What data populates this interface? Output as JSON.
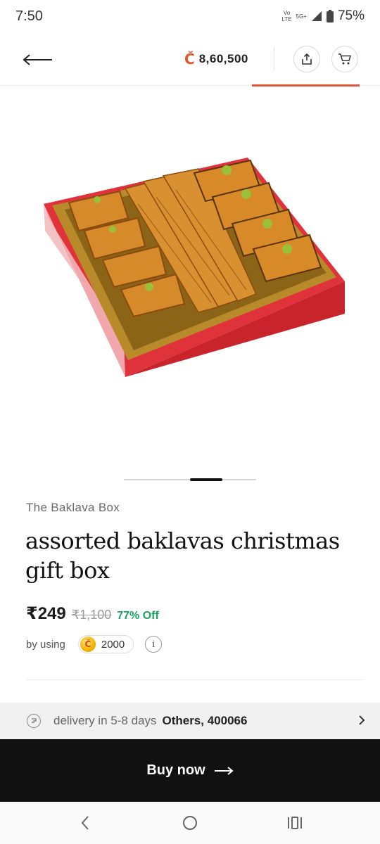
{
  "status": {
    "time": "7:50",
    "network_top": "Vo",
    "network_bottom": "LTE",
    "signal_label": "5G+",
    "battery": "75%"
  },
  "header": {
    "coin_symbol": "C̆",
    "coin_balance": "8,60,500"
  },
  "product": {
    "brand": "The Baklava Box",
    "title": "assorted baklavas christmas gift box",
    "price": "₹249",
    "mrp": "₹1,100",
    "discount": "77% Off",
    "using_label": "by using",
    "coins_required": "2000",
    "info_glyph": "i"
  },
  "delivery": {
    "text": "delivery in 5-8 days",
    "location": "Others, 400066"
  },
  "cta": {
    "label": "Buy now",
    "arrow": "⟶"
  },
  "colors": {
    "accent": "#e2573a",
    "discount": "#1aa260",
    "cta_bg": "#111111"
  },
  "icons": [
    "back-arrow-icon",
    "share-icon",
    "cart-icon",
    "coin-icon",
    "info-icon",
    "delivery-icon",
    "chevron-right-icon",
    "nav-back-icon",
    "nav-home-icon",
    "nav-recents-icon"
  ]
}
